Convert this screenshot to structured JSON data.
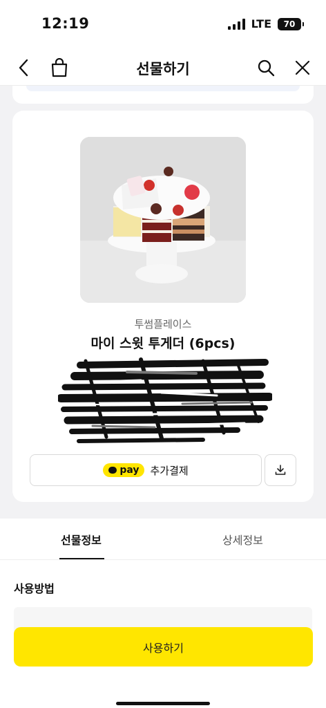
{
  "status_bar": {
    "time": "12:19",
    "network": "LTE",
    "battery": "70"
  },
  "header": {
    "title": "선물하기",
    "back_icon": "chevron-left-icon",
    "shop_icon": "shopping-bag-icon",
    "search_icon": "search-icon",
    "close_icon": "close-icon"
  },
  "product": {
    "brand": "투썸플레이스",
    "name": "마이 스윗 투게더 (6pcs)",
    "image": "cake-photo",
    "pay_badge": "pay",
    "pay_label": "추가결제",
    "download_icon": "download-icon"
  },
  "tabs": [
    {
      "label": "선물정보",
      "active": true
    },
    {
      "label": "상세정보",
      "active": false
    }
  ],
  "usage": {
    "title": "사용방법"
  },
  "cta": {
    "label": "사용하기"
  },
  "colors": {
    "accent": "#ffe600",
    "background": "#f2f2f4"
  }
}
